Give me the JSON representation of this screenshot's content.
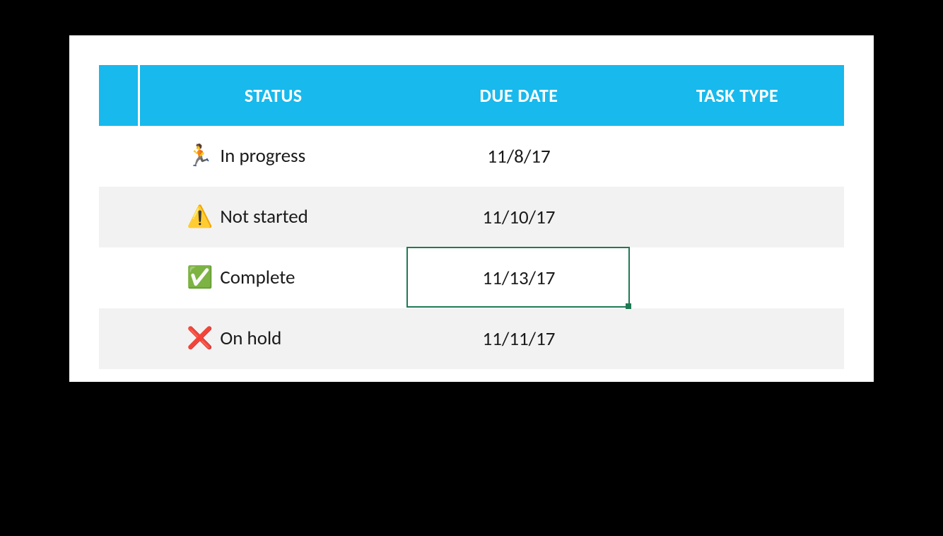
{
  "headers": {
    "blank": "",
    "status": "STATUS",
    "due_date": "DUE DATE",
    "task_type": "TASK TYPE"
  },
  "rows": [
    {
      "icon": "🏃",
      "icon_name": "running-icon",
      "status": "In progress",
      "due_date": "11/8/17",
      "task_type": ""
    },
    {
      "icon": "⚠️",
      "icon_name": "warning-icon",
      "status": "Not started",
      "due_date": "11/10/17",
      "task_type": ""
    },
    {
      "icon": "✅",
      "icon_name": "checkmark-icon",
      "status": "Complete",
      "due_date": "11/13/17",
      "task_type": ""
    },
    {
      "icon": "❌",
      "icon_name": "cross-icon",
      "status": "On hold",
      "due_date": "11/11/17",
      "task_type": ""
    }
  ],
  "selected_cell": {
    "row": 2,
    "col": "due_date"
  }
}
